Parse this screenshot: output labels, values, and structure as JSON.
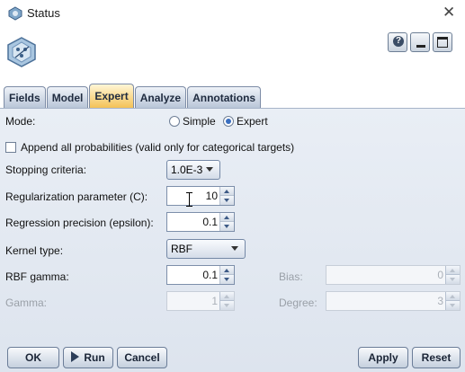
{
  "window": {
    "title": "Status",
    "close_icon": "close-icon"
  },
  "header": {
    "node_icon": "svm-node-icon",
    "buttons": [
      "help-icon",
      "minimize-icon",
      "maximize-icon"
    ]
  },
  "tabs": [
    {
      "label": "Fields",
      "active": false
    },
    {
      "label": "Model",
      "active": false
    },
    {
      "label": "Expert",
      "active": true
    },
    {
      "label": "Analyze",
      "active": false
    },
    {
      "label": "Annotations",
      "active": false
    }
  ],
  "form": {
    "mode_label": "Mode:",
    "mode_simple": "Simple",
    "mode_expert": "Expert",
    "mode_selected": "Expert",
    "append_label": "Append all probabilities (valid only for categorical targets)",
    "append_checked": false,
    "stopping_label": "Stopping criteria:",
    "stopping_value": "1.0E-3",
    "regularization_label": "Regularization parameter (C):",
    "regularization_value": "10",
    "regression_label": "Regression precision (epsilon):",
    "regression_value": "0.1",
    "kernel_label": "Kernel type:",
    "kernel_value": "RBF",
    "rbf_label": "RBF gamma:",
    "rbf_value": "0.1",
    "bias_label": "Bias:",
    "bias_value": "0",
    "gamma_label": "Gamma:",
    "gamma_value": "1",
    "degree_label": "Degree:",
    "degree_value": "3"
  },
  "footer": {
    "ok": "OK",
    "run": "Run",
    "cancel": "Cancel",
    "apply": "Apply",
    "reset": "Reset"
  },
  "colors": {
    "active_tab": "#f4c257",
    "panel": "#e4eaf2",
    "radio_dot": "#3a6fc0"
  }
}
